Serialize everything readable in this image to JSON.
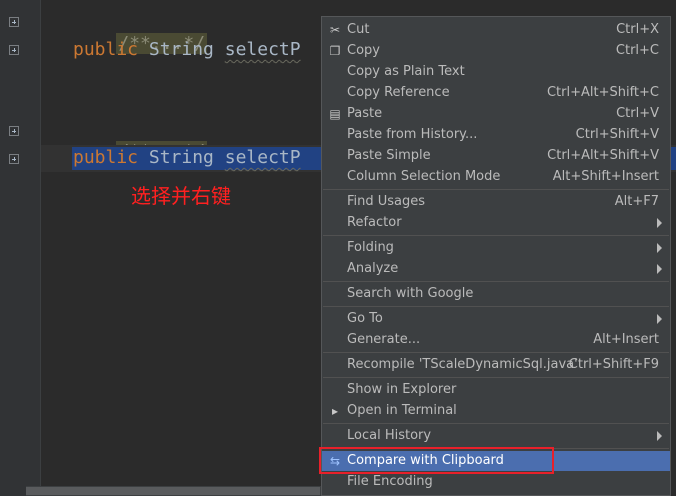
{
  "editor": {
    "lines": [
      {
        "comment": "/**...*/"
      },
      {
        "keyword": "public",
        "type": "String",
        "method": "selectP"
      },
      {
        "comment": "/**...*/"
      },
      {
        "keyword": "public",
        "type": "String",
        "method": "selectP"
      }
    ],
    "annotation": "选择并右键"
  },
  "context_menu": {
    "items": [
      {
        "label": "Cut",
        "shortcut": "Ctrl+X",
        "icon": "scissors-icon"
      },
      {
        "label": "Copy",
        "shortcut": "Ctrl+C",
        "icon": "copy-icon"
      },
      {
        "label": "Copy as Plain Text",
        "shortcut": ""
      },
      {
        "label": "Copy Reference",
        "shortcut": "Ctrl+Alt+Shift+C"
      },
      {
        "label": "Paste",
        "shortcut": "Ctrl+V",
        "icon": "clipboard-icon"
      },
      {
        "label": "Paste from History...",
        "shortcut": "Ctrl+Shift+V"
      },
      {
        "label": "Paste Simple",
        "shortcut": "Ctrl+Alt+Shift+V"
      },
      {
        "label": "Column Selection Mode",
        "shortcut": "Alt+Shift+Insert"
      },
      {
        "label": "Find Usages",
        "shortcut": "Alt+F7"
      },
      {
        "label": "Refactor",
        "shortcut": ""
      },
      {
        "label": "Folding",
        "shortcut": ""
      },
      {
        "label": "Analyze",
        "shortcut": ""
      },
      {
        "label": "Search with Google",
        "shortcut": ""
      },
      {
        "label": "Go To",
        "shortcut": ""
      },
      {
        "label": "Generate...",
        "shortcut": "Alt+Insert"
      },
      {
        "label": "Recompile 'TScaleDynamicSql.java'",
        "shortcut": "Ctrl+Shift+F9"
      },
      {
        "label": "Show in Explorer",
        "shortcut": ""
      },
      {
        "label": "Open in Terminal",
        "shortcut": "",
        "icon": "terminal-icon"
      },
      {
        "label": "Local History",
        "shortcut": ""
      },
      {
        "label": "Compare with Clipboard",
        "shortcut": "",
        "icon": "compare-icon",
        "highlighted": true
      },
      {
        "label": "File Encoding",
        "shortcut": ""
      }
    ]
  }
}
